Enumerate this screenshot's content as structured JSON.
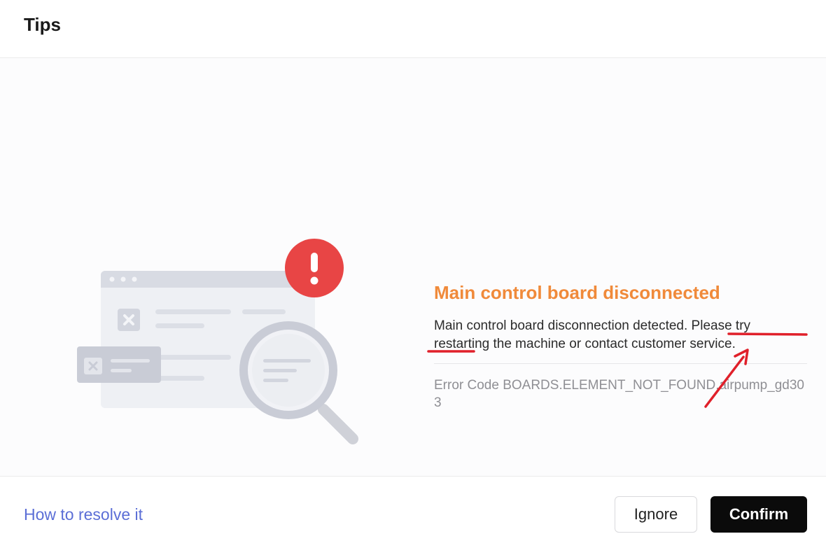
{
  "dialog": {
    "title": "Tips"
  },
  "alert": {
    "heading": "Main control board disconnected",
    "message": "Main control board disconnection detected. Please try restarting the machine or contact customer service.",
    "error_code": "Error Code BOARDS.ELEMENT_NOT_FOUND.airpump_gd303"
  },
  "footer": {
    "help_link": "How to resolve it",
    "ignore_label": "Ignore",
    "confirm_label": "Confirm"
  },
  "colors": {
    "heading": "#f08a3a",
    "confirm_bg": "#0b0b0b",
    "alert_badge": "#e84545",
    "annotation": "#e0202a",
    "link": "#5b6ed6"
  },
  "icons": [
    "error-illustration",
    "exclamation-badge-icon",
    "magnifier-icon",
    "close-x-icon"
  ]
}
